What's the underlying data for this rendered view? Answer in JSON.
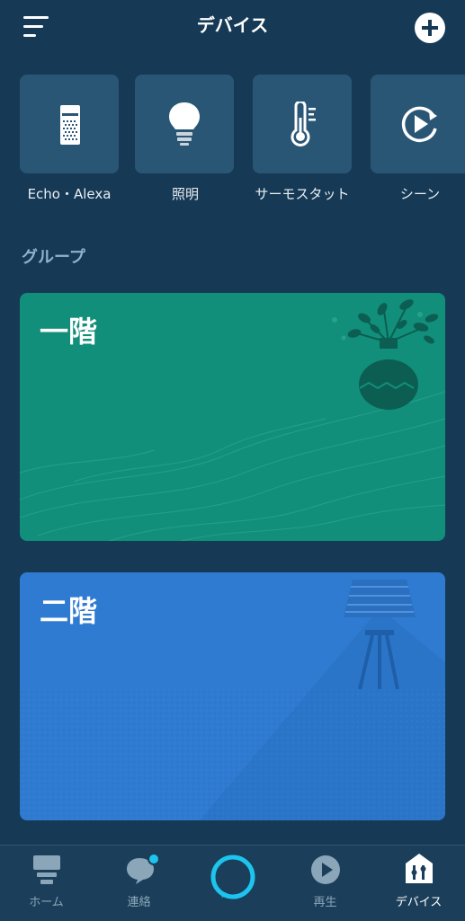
{
  "header": {
    "title": "デバイス",
    "menu_icon": "hamburger-menu-icon",
    "add_icon": "plus-icon"
  },
  "categories": [
    {
      "label": "Echo・Alexa",
      "icon": "echo-speaker-icon"
    },
    {
      "label": "照明",
      "icon": "lightbulb-icon"
    },
    {
      "label": "サーモスタット",
      "icon": "thermometer-icon"
    },
    {
      "label": "シーン",
      "icon": "scene-play-icon"
    }
  ],
  "groups_section": {
    "title": "グループ",
    "items": [
      {
        "name": "一階",
        "color": "#118f7a",
        "illustration": "plant-vase-illustration"
      },
      {
        "name": "二階",
        "color": "#2f7bd1",
        "illustration": "lamp-illustration"
      }
    ]
  },
  "tabbar": {
    "tabs": [
      {
        "label": "ホーム",
        "icon": "home-icon",
        "active": false
      },
      {
        "label": "連絡",
        "icon": "chat-bubble-icon",
        "active": false,
        "badge": true
      },
      {
        "label": "",
        "icon": "alexa-ring-icon",
        "active": false
      },
      {
        "label": "再生",
        "icon": "play-icon",
        "active": false
      },
      {
        "label": "デバイス",
        "icon": "devices-icon",
        "active": true
      }
    ]
  },
  "colors": {
    "background": "#163a55",
    "tile": "#2a5675",
    "accent_alexa": "#1cc4ee",
    "group_1": "#118f7a",
    "group_2": "#2f7bd1"
  }
}
